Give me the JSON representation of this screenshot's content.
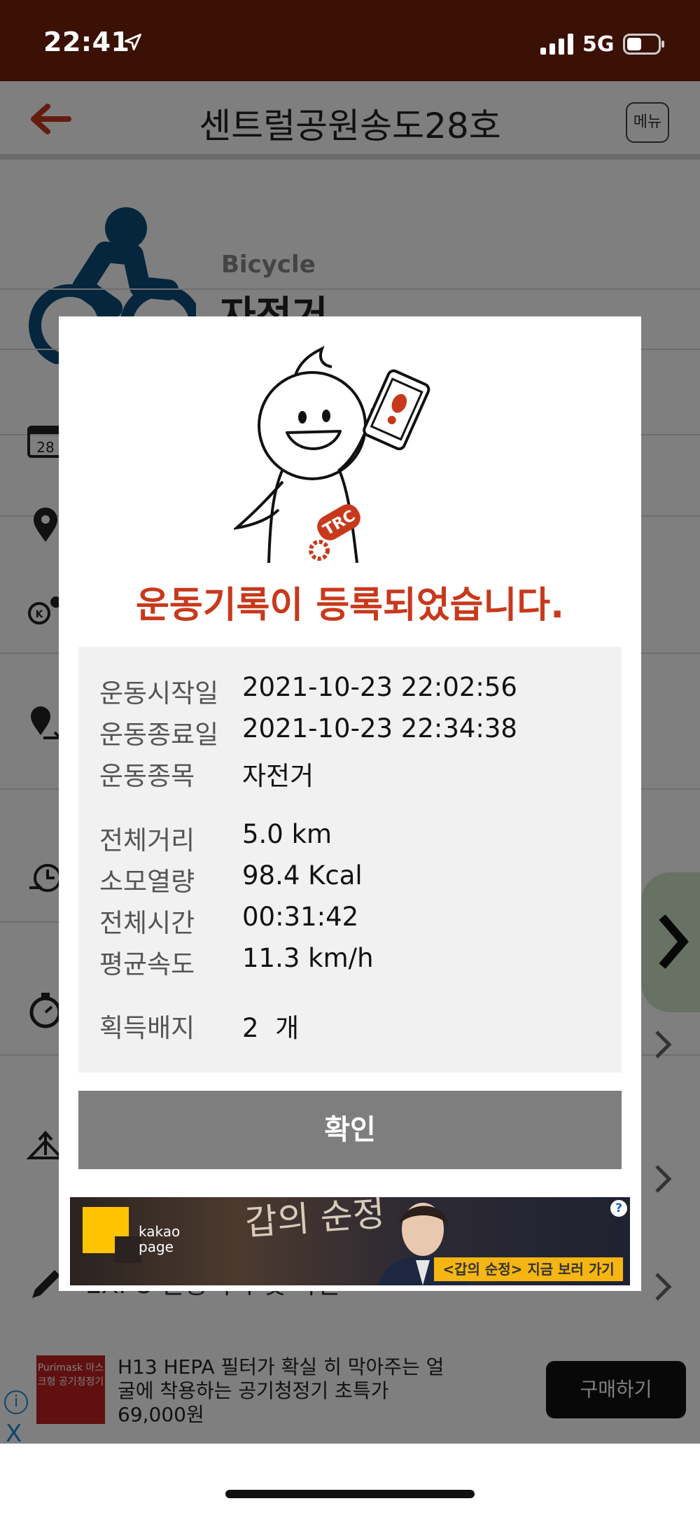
{
  "status_bar": {
    "time": "22:41",
    "network": "5G"
  },
  "header": {
    "title": "센트럴공원송도28호",
    "menu_label": "메뉴"
  },
  "activity": {
    "sport_en": "Bicycle",
    "sport_ko": "자전거"
  },
  "background_rows": {
    "edit_label": "EXPO 운동기록 및 사진"
  },
  "modal": {
    "title": "운동기록이 등록되었습니다.",
    "info_group1": [
      {
        "label": "운동시작일",
        "value": "2021-10-23 22:02:56"
      },
      {
        "label": "운동종료일",
        "value": "2021-10-23 22:34:38"
      },
      {
        "label": "운동종목",
        "value": "자전거"
      }
    ],
    "info_group2": [
      {
        "label": "전체거리",
        "value": "5.0 km"
      },
      {
        "label": "소모열량",
        "value": "98.4 Kcal"
      },
      {
        "label": "전체시간",
        "value": "00:31:42"
      },
      {
        "label": "평균속도",
        "value": "11.3 km/h"
      }
    ],
    "info_group3": [
      {
        "label": "획득배지",
        "value": "2  개"
      }
    ],
    "confirm_label": "확인",
    "ad": {
      "brand": "kakao page",
      "headline": "갑의 순정",
      "cta": "<갑의 순정> 지금 보러 가기",
      "help": "?"
    },
    "mascot_badge": "TRC"
  },
  "bottom_ad": {
    "logo_text": "Purimask 마스크형 공기청정기",
    "text": "H13 HEPA 필터가 확실 히 막아주는 얼굴에 착용하는 공기청정기 초특가 69,000원",
    "button": "구매하기",
    "info_icon": "i",
    "close_icon": "X"
  },
  "colors": {
    "status_bar_bg": "#3b1005",
    "accent_red": "#c8391c",
    "confirm_button": "#7e7e7e",
    "info_panel_bg": "#f1f1f1"
  }
}
